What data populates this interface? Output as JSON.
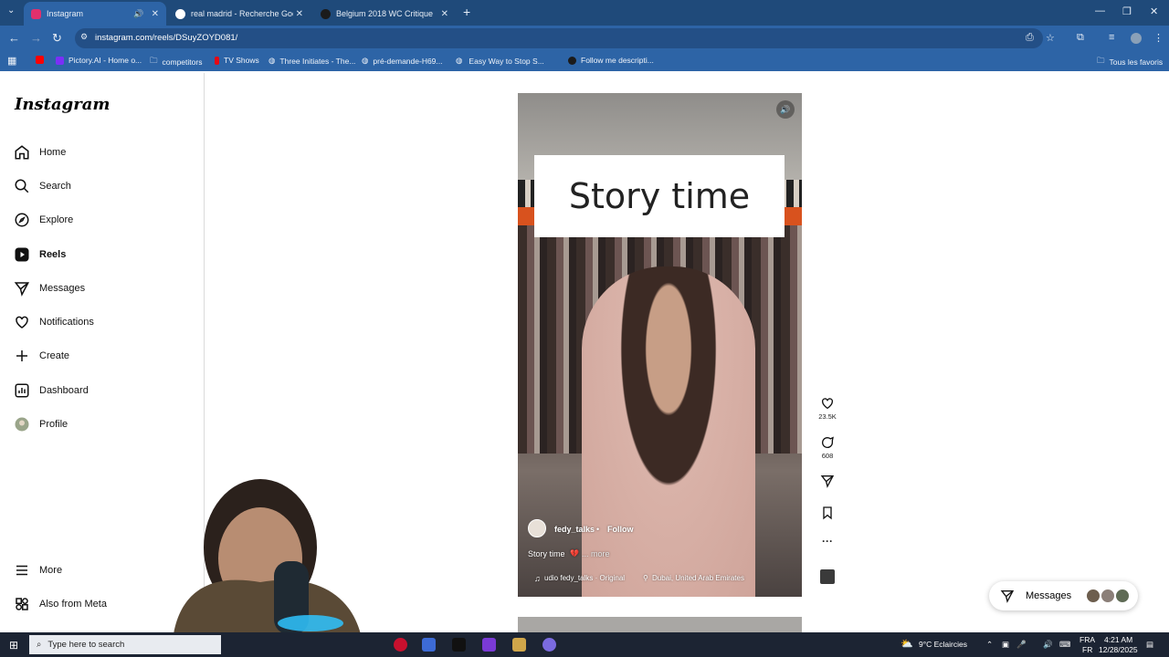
{
  "browser": {
    "tabs": [
      {
        "title": "Instagram",
        "active": true,
        "favicon_color": "#e1306c"
      },
      {
        "title": "real madrid - Recherche Google",
        "active": false,
        "favicon_color": "#ffffff"
      },
      {
        "title": "Belgium 2018 WC Critique",
        "active": false,
        "favicon_color": "#1b1b1b"
      }
    ],
    "url": "instagram.com/reels/DSuyZOYD081/",
    "bookmarks": [
      {
        "label": "",
        "icon": "youtube-icon",
        "color": "#ff0000"
      },
      {
        "label": "Pictory.AI - Home o...",
        "icon": "pictory-icon",
        "color": "#7b2ff7"
      },
      {
        "label": "competitors",
        "icon": "folder-icon",
        "color": "#f0f4fa"
      },
      {
        "label": "TV Shows",
        "icon": "tv-icon",
        "color": "#e50914"
      },
      {
        "label": "Three Initiates - The...",
        "icon": "globe-icon",
        "color": "#f0f4fa"
      },
      {
        "label": "pré-demande-H69...",
        "icon": "globe-icon",
        "color": "#f0f4fa"
      },
      {
        "label": "Easy Way to Stop S...",
        "icon": "globe-icon",
        "color": "#f0f4fa"
      },
      {
        "label": "Follow me descripti...",
        "icon": "globe-icon",
        "color": "#1b1b1b"
      }
    ],
    "bookmarks_all": "Tous les favoris"
  },
  "sidebar": {
    "logo": "Instagram",
    "items": [
      {
        "label": "Home",
        "icon": "home-icon",
        "active": false
      },
      {
        "label": "Search",
        "icon": "search-icon",
        "active": false
      },
      {
        "label": "Explore",
        "icon": "compass-icon",
        "active": false
      },
      {
        "label": "Reels",
        "icon": "reels-icon",
        "active": true
      },
      {
        "label": "Messages",
        "icon": "send-icon",
        "active": false
      },
      {
        "label": "Notifications",
        "icon": "heart-icon",
        "active": false
      },
      {
        "label": "Create",
        "icon": "plus-icon",
        "active": false
      },
      {
        "label": "Dashboard",
        "icon": "dashboard-icon",
        "active": false
      },
      {
        "label": "Profile",
        "icon": "profile-avatar",
        "active": false
      }
    ],
    "more": "More",
    "meta": "Also from Meta"
  },
  "reel": {
    "overlay_text": "Story time",
    "username": "fedy_talks",
    "separator": "•",
    "follow": "Follow",
    "caption": "Story time",
    "caption_emoji": "💔",
    "more": "... more",
    "audio": "udio  fedy_talks · Original",
    "location": "Dubai, United Arab Emirates",
    "likes": "23.5K",
    "comments": "608"
  },
  "messages_pill": {
    "label": "Messages"
  },
  "taskbar": {
    "search_placeholder": "Type here to search",
    "weather": "9°C  Eclaircies",
    "lang1": "FRA",
    "lang2": "FR",
    "time": "4:21 AM",
    "date": "12/28/2025"
  }
}
